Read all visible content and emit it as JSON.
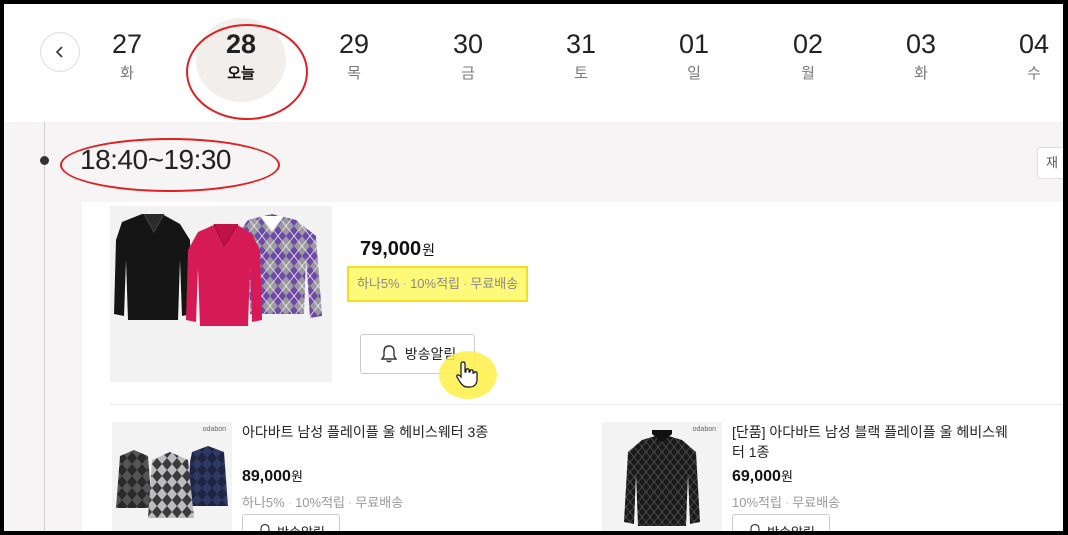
{
  "dates": [
    {
      "num": "27",
      "dow": "화"
    },
    {
      "num": "28",
      "dow": "오늘",
      "today": true
    },
    {
      "num": "29",
      "dow": "목"
    },
    {
      "num": "30",
      "dow": "금"
    },
    {
      "num": "31",
      "dow": "토"
    },
    {
      "num": "01",
      "dow": "일"
    },
    {
      "num": "02",
      "dow": "월"
    },
    {
      "num": "03",
      "dow": "화"
    },
    {
      "num": "04",
      "dow": "수"
    }
  ],
  "broadcast": {
    "time": "18:40~19:30",
    "side_button": "재"
  },
  "main_product": {
    "price": "79,000",
    "currency": "원",
    "benefits": [
      "하나5%",
      "10%적립",
      "무료배송"
    ],
    "alarm_label": "방송알림"
  },
  "sub_products": [
    {
      "brand": "odabon",
      "title": "아다바트 남성 플레이플 울 헤비스웨터 3종",
      "price": "89,000",
      "currency": "원",
      "benefits": [
        "하나5%",
        "10%적립",
        "무료배송"
      ],
      "alarm_label": "방송알림"
    },
    {
      "brand": "odabon",
      "title": "[단품] 아다바트 남성 블랙 플레이플 울 헤비스웨터 1종",
      "price": "69,000",
      "currency": "원",
      "benefits": [
        "10%적립",
        "무료배송"
      ],
      "alarm_label": "방송알림"
    }
  ],
  "colors": {
    "highlight": "#fff97a",
    "annotation": "#e02020"
  }
}
